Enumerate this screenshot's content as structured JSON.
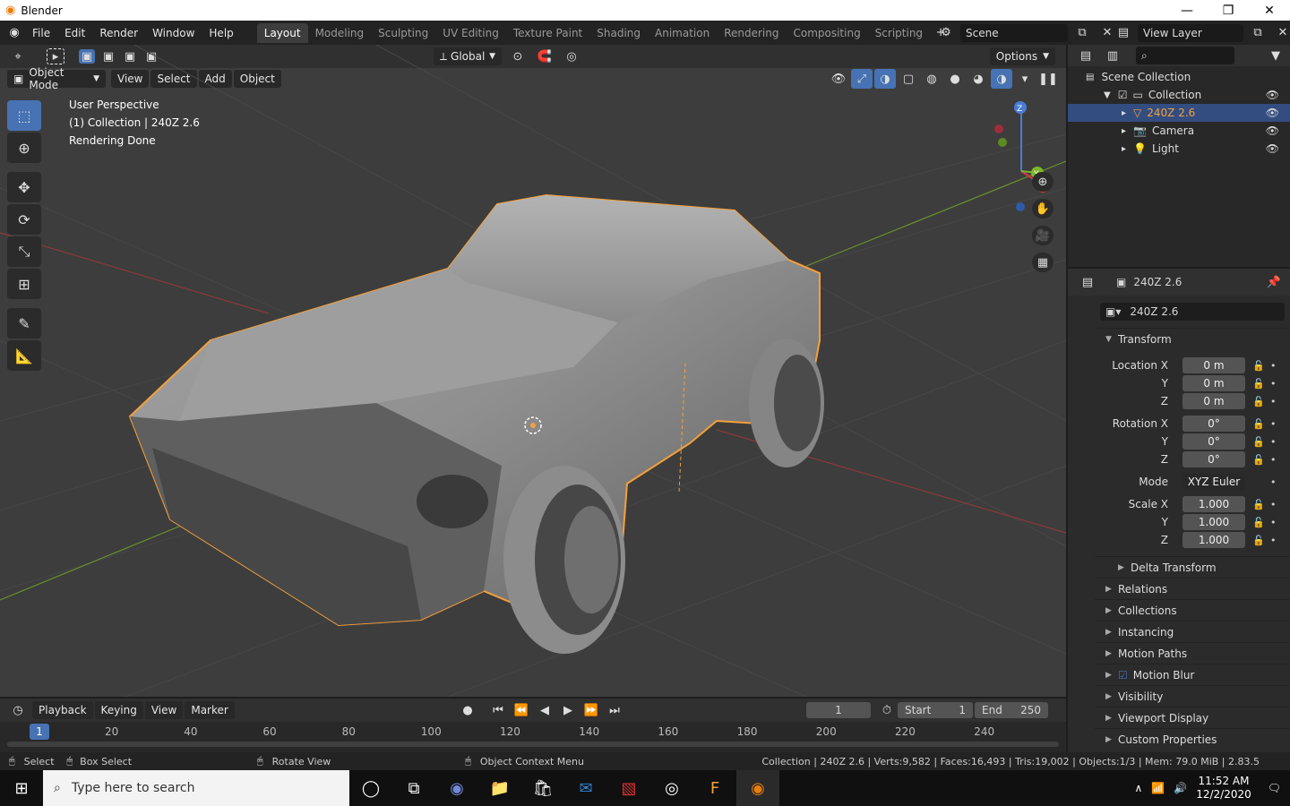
{
  "window": {
    "title": "Blender",
    "min": "—",
    "max": "❐",
    "close": "✕"
  },
  "menu": [
    "File",
    "Edit",
    "Render",
    "Window",
    "Help"
  ],
  "workspaces": [
    "Layout",
    "Modeling",
    "Sculpting",
    "UV Editing",
    "Texture Paint",
    "Shading",
    "Animation",
    "Rendering",
    "Compositing",
    "Scripting"
  ],
  "active_workspace": "Layout",
  "scene": "Scene",
  "view_layer": "View Layer",
  "tool_header": {
    "orientation": "Global",
    "options": "Options"
  },
  "viewport_header": {
    "mode": "Object Mode",
    "menus": [
      "View",
      "Select",
      "Add",
      "Object"
    ]
  },
  "viewport_overlay": {
    "line1": "User Perspective",
    "line2": "(1) Collection | 240Z 2.6",
    "line3": "Rendering Done"
  },
  "gizmo": {
    "x": "X",
    "y": "Y",
    "z": "Z"
  },
  "outliner": {
    "rows": [
      {
        "label": "Scene Collection",
        "indent": 0,
        "selected": false,
        "eye": false
      },
      {
        "label": "Collection",
        "indent": 1,
        "selected": false,
        "eye": true
      },
      {
        "label": "240Z 2.6",
        "indent": 2,
        "selected": true,
        "eye": true
      },
      {
        "label": "Camera",
        "indent": 2,
        "selected": false,
        "eye": true
      },
      {
        "label": "Light",
        "indent": 2,
        "selected": false,
        "eye": true
      }
    ]
  },
  "properties": {
    "object_name": "240Z 2.6",
    "field_name": "240Z 2.6",
    "transform_title": "Transform",
    "location_label": "Location X",
    "rotation_label": "Rotation X",
    "scale_label": "Scale X",
    "y_label": "Y",
    "z_label": "Z",
    "location": [
      "0 m",
      "0 m",
      "0 m"
    ],
    "rotation": [
      "0°",
      "0°",
      "0°"
    ],
    "mode_label": "Mode",
    "mode": "XYZ Euler",
    "scale": [
      "1.000",
      "1.000",
      "1.000"
    ],
    "delta_transform": "Delta Transform",
    "panels": [
      "Relations",
      "Collections",
      "Instancing",
      "Motion Paths",
      "Motion Blur",
      "Visibility",
      "Viewport Display",
      "Custom Properties"
    ]
  },
  "timeline": {
    "menus": [
      "Playback",
      "Keying",
      "View",
      "Marker"
    ],
    "current_frame": "1",
    "start_label": "Start",
    "start": "1",
    "end_label": "End",
    "end": "250",
    "ticks": [
      "20",
      "40",
      "60",
      "80",
      "100",
      "120",
      "140",
      "160",
      "180",
      "200",
      "220",
      "240"
    ]
  },
  "status": {
    "select": "Select",
    "box_select": "Box Select",
    "rotate_view": "Rotate View",
    "context_menu": "Object Context Menu",
    "stats": "Collection | 240Z 2.6 | Verts:9,582 | Faces:16,493 | Tris:19,002 | Objects:1/3 | Mem: 79.0 MiB | 2.83.5"
  },
  "taskbar": {
    "search_placeholder": "Type here to search",
    "time": "11:52 AM",
    "date": "12/2/2020"
  },
  "colors": {
    "accent": "#4772b3",
    "selection_outline": "#f5a03a",
    "viewport_bg": "#3d3d3d"
  }
}
